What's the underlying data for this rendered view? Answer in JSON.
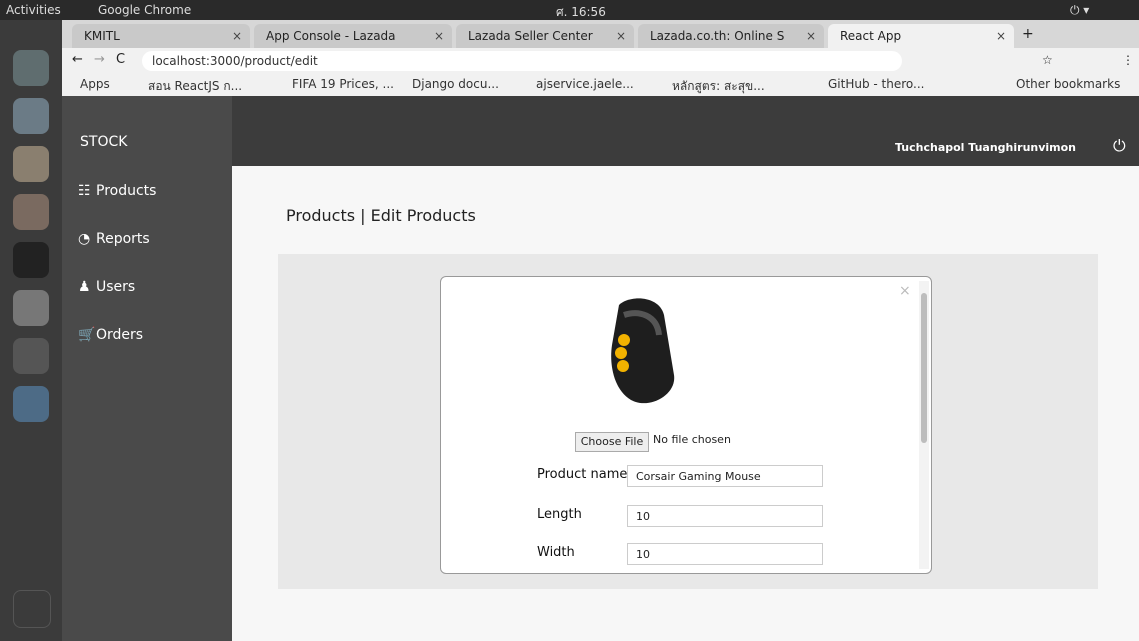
{
  "system": {
    "activities": "Activities",
    "browser_name": "Google Chrome",
    "clock": "ศ. 16:56"
  },
  "tabs": [
    {
      "label": "KMITL"
    },
    {
      "label": "App Console - Lazada"
    },
    {
      "label": "Lazada Seller Center"
    },
    {
      "label": "Lazada.co.th: Online S"
    },
    {
      "label": "React App"
    }
  ],
  "address": {
    "url": "localhost:3000/product/edit"
  },
  "bookmarks": [
    "Apps",
    "สอน ReactJS ก...",
    "FIFA 19 Prices, ...",
    "Django docu...",
    "ajservice.jaele...",
    "หลักสูตร: สะสุข...",
    "GitHub - thero...",
    "Other bookmarks"
  ],
  "sidebar": {
    "brand": "STOCK",
    "items": [
      {
        "label": "Products"
      },
      {
        "label": "Reports"
      },
      {
        "label": "Users"
      },
      {
        "label": "Orders"
      }
    ]
  },
  "header": {
    "user_name": "Tuchchapol Tuanghirunvimon"
  },
  "page": {
    "title": "Products | Edit Products"
  },
  "form": {
    "file_button": "Choose File",
    "file_status": "No file chosen",
    "product_name_label": "Product name",
    "product_name_value": "Corsair Gaming Mouse",
    "length_label": "Length",
    "length_value": "10",
    "width_label": "Width",
    "width_value": "10"
  }
}
